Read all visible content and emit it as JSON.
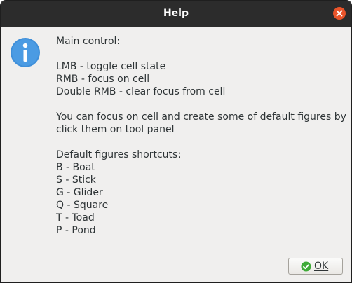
{
  "window": {
    "title": "Help"
  },
  "icons": {
    "close": "close-icon",
    "info": "info-icon",
    "ok": "check-circle-icon"
  },
  "message": {
    "main_control_heading": "Main control:",
    "controls": [
      "LMB - toggle cell state",
      "RMB - focus on cell",
      "Double RMB - clear focus from cell"
    ],
    "focus_hint": [
      "You can focus on cell and create some of default figures by",
      "click them on tool panel"
    ],
    "shortcuts_heading": "Default figures shortcuts:",
    "shortcuts": [
      "B - Boat",
      "S - Stick",
      "G - Glider",
      "Q - Square",
      "T - Toad",
      "P - Pond"
    ]
  },
  "buttons": {
    "ok_label": "OK"
  },
  "colors": {
    "titlebar": "#2c2c2c",
    "close_button": "#e9542a",
    "info_icon": "#3f8fd9",
    "ok_check": "#3faa38"
  }
}
